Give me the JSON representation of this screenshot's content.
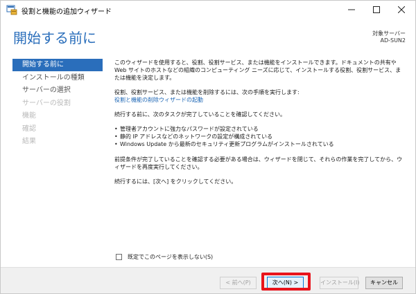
{
  "window": {
    "title": "役割と機能の追加ウィザード",
    "icons": {
      "app": "server-manager-icon",
      "minimize": "minimize-icon",
      "maximize": "maximize-icon",
      "close": "close-icon"
    }
  },
  "header": {
    "title": "開始する前に",
    "target_label": "対象サーバー",
    "target_value": "AD-SUN2"
  },
  "nav": {
    "items": [
      {
        "label": "開始する前に",
        "state": "active"
      },
      {
        "label": "インストールの種類",
        "state": "normal"
      },
      {
        "label": "サーバーの選択",
        "state": "normal"
      },
      {
        "label": "サーバーの役割",
        "state": "disabled"
      },
      {
        "label": "機能",
        "state": "disabled"
      },
      {
        "label": "確認",
        "state": "disabled"
      },
      {
        "label": "結果",
        "state": "disabled"
      }
    ]
  },
  "content": {
    "intro": "このウィザードを使用すると、役割、役割サービス、または機能をインストールできます。ドキュメントの共有や Web サイトのホストなどの組織のコンピューティング ニーズに応じて、インストールする役割、役割サービス、または機能を決定します。",
    "remove_text": "役割、役割サービス、または機能を削除するには、次の手順を実行します:",
    "remove_link": "役割と機能の削除ウィザードの起動",
    "verify_text": "続行する前に、次のタスクが完了していることを確認してください。",
    "bullets": [
      "管理者アカウントに強力なパスワードが設定されている",
      "静的 IP アドレスなどのネットワークの設定が構成されている",
      "Windows Update から最新のセキュリティ更新プログラムがインストールされている"
    ],
    "prereq_text": "前提条件が完了していることを確認する必要がある場合は、ウィザードを閉じて、それらの作業を完了してから、ウィザードを再度実行してください。",
    "continue_text": "続行するには、[次へ] をクリックしてください。"
  },
  "skip_checkbox": {
    "label": "既定でこのページを表示しない(S)",
    "checked": false
  },
  "footer": {
    "back": "< 前へ(P)",
    "next": "次へ(N) >",
    "install": "インストール(I)",
    "cancel": "キャンセル"
  },
  "colors": {
    "accent": "#2a6ebb",
    "highlight": "#e8131b"
  }
}
